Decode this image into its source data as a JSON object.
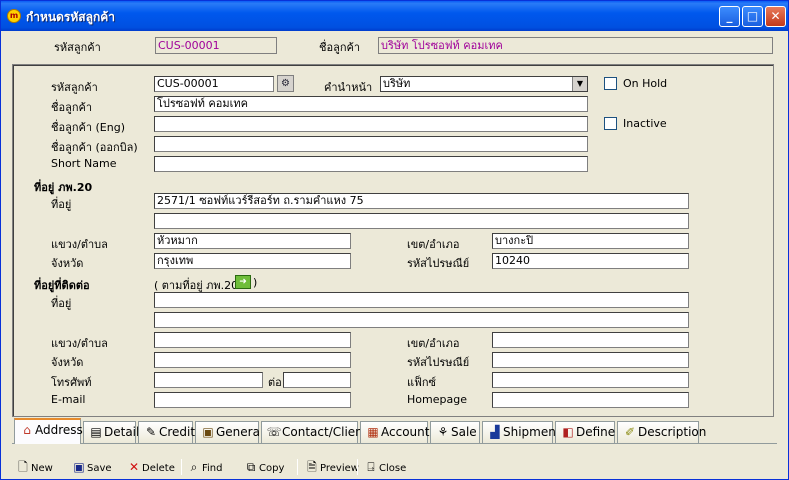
{
  "window": {
    "title": "กำหนดรหัสลูกค้า",
    "icon": "app-logo-icon",
    "controls": [
      "minimize",
      "maximize",
      "close"
    ]
  },
  "header": {
    "code_label": "รหัสลูกค้า",
    "code_value": "CUS-00001",
    "name_label": "ชื่อลูกค้า",
    "name_value": "บริษัท โปรซอฟท์ คอมเทค"
  },
  "form": {
    "code_label": "รหัสลูกค้า",
    "code_value": "CUS-00001",
    "prefix_label": "คำนำหน้า",
    "prefix_value": "บริษัท",
    "on_hold_label": "On Hold",
    "name_label": "ชื่อลูกค้า",
    "name_value": "โปรซอฟท์ คอมเทค",
    "name_eng_label": "ชื่อลูกค้า (Eng)",
    "name_eng_value": "",
    "inactive_label": "Inactive",
    "name_bill_label": "ชื่อลูกค้า (ออกบิล)",
    "name_bill_value": "",
    "short_name_label": "Short Name",
    "short_name_value": "",
    "tax_section_title": "ที่อยู่ ภพ.20",
    "tax_address_label": "ที่อยู่",
    "tax_address_line1": "2571/1 ซอฟท์แวร์รีสอร์ท ถ.รามคำแหง 75",
    "tax_address_line2": "",
    "tax_subdistrict_label": "แขวง/ตำบล",
    "tax_subdistrict_value": "หัวหมาก",
    "tax_district_label": "เขต/อำเภอ",
    "tax_district_value": "บางกะปิ",
    "tax_province_label": "จังหวัด",
    "tax_province_value": "กรุงเทพ",
    "tax_postcode_label": "รหัสไปรษณีย์",
    "tax_postcode_value": "10240",
    "contact_section_title": "ที่อยู่ที่ติดต่อ",
    "copy_from_tax_open": "( ตามที่อยู่ ภพ.20",
    "copy_from_tax_close": ")",
    "contact_address_label": "ที่อยู่",
    "contact_address_line1": "",
    "contact_address_line2": "",
    "contact_subdistrict_label": "แขวง/ตำบล",
    "contact_subdistrict_value": "",
    "contact_district_label": "เขต/อำเภอ",
    "contact_district_value": "",
    "contact_province_label": "จังหวัด",
    "contact_province_value": "",
    "contact_postcode_label": "รหัสไปรษณีย์",
    "contact_postcode_value": "",
    "phone_label": "โทรศัพท์",
    "phone_value": "",
    "ext_label": "ต่อ",
    "ext_value": "",
    "fax_label": "แฟ็กซ์",
    "fax_value": "",
    "email_label": "E-mail",
    "email_value": "",
    "homepage_label": "Homepage",
    "homepage_value": ""
  },
  "tabs": [
    {
      "label": "Address",
      "icon": "home-icon",
      "active": true
    },
    {
      "label": "Detail",
      "icon": "detail-icon"
    },
    {
      "label": "Credit",
      "icon": "credit-icon"
    },
    {
      "label": "General",
      "icon": "general-icon"
    },
    {
      "label": "Contact/Client",
      "icon": "contact-icon"
    },
    {
      "label": "Account",
      "icon": "account-icon"
    },
    {
      "label": "Sale",
      "icon": "sale-icon"
    },
    {
      "label": "Shipment",
      "icon": "shipment-icon"
    },
    {
      "label": "Define",
      "icon": "define-icon"
    },
    {
      "label": "Description",
      "icon": "description-icon"
    }
  ],
  "toolbar": {
    "new": "New",
    "save": "Save",
    "delete": "Delete",
    "find": "Find",
    "copy": "Copy",
    "preview": "Preview",
    "close": "Close"
  },
  "colors": {
    "titlebar": "#0058ee",
    "window_bg": "#ece9d8",
    "readonly_text": "#a0009a",
    "active_tab_accent": "#e68b2c"
  }
}
